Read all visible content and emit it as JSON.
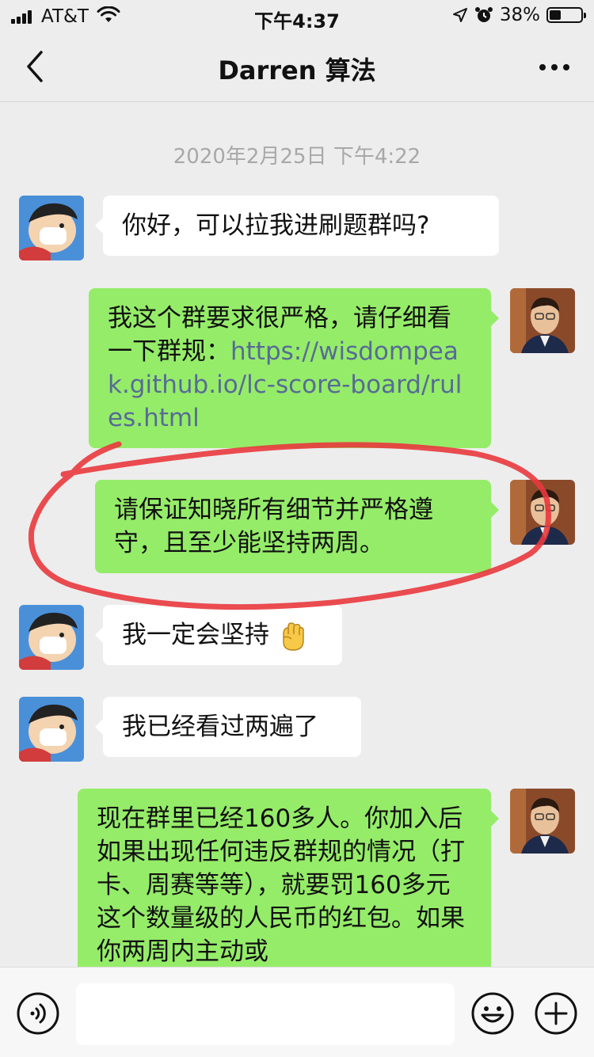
{
  "status_bar": {
    "carrier": "AT&T",
    "time": "下午4:37",
    "battery_percent": "38%",
    "battery_level": 0.38,
    "icons": [
      "signal-icon",
      "wifi-icon",
      "location-arrow-icon",
      "alarm-icon",
      "battery-icon"
    ]
  },
  "nav": {
    "title": "Darren 算法",
    "back_icon": "chevron-left-icon",
    "more_icon": "more-dots-icon"
  },
  "chat": {
    "timestamp": "2020年2月25日 下午4:22",
    "messages": [
      {
        "sender": "other",
        "text": "你好，可以拉我进刷题群吗?"
      },
      {
        "sender": "me",
        "text": "我这个群要求很严格，请仔细看一下群规：",
        "link": "https://wisdompeak.github.io/lc-score-board/rules.html"
      },
      {
        "sender": "me",
        "text": "请保证知晓所有细节并严格遵守，且至少能坚持两周。",
        "highlighted": true
      },
      {
        "sender": "other",
        "text": "我一定会坚持",
        "emoji": "raised-fist-emoji"
      },
      {
        "sender": "other",
        "text": "我已经看过两遍了"
      },
      {
        "sender": "me",
        "text": "现在群里已经160多人。你加入后如果出现任何违反群规的情况（打卡、周赛等等），就要罚160多元这个数量级的人民币的红包。如果你两周内主动或"
      }
    ]
  },
  "input_bar": {
    "value": "",
    "icons": [
      "voice-icon",
      "emoji-face-icon",
      "plus-circle-icon"
    ]
  },
  "colors": {
    "background": "#ededed",
    "outgoing_bubble": "#95ec69",
    "incoming_bubble": "#ffffff",
    "link": "#576b95",
    "annotation": "#e8383d"
  }
}
